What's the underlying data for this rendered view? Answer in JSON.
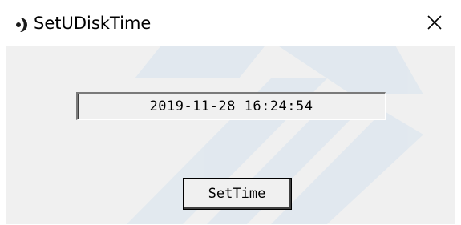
{
  "window": {
    "title": "SetUDiskTime",
    "app_icon": "moon-crescent-icon",
    "close_icon": "close-icon"
  },
  "main": {
    "datetime_value": "2019-11-28 16:24:54",
    "settime_label": "SetTime"
  },
  "colors": {
    "client_background": "#f0f0f0",
    "titlebar_background": "#ffffff",
    "watermark": "#dbe4ee"
  }
}
